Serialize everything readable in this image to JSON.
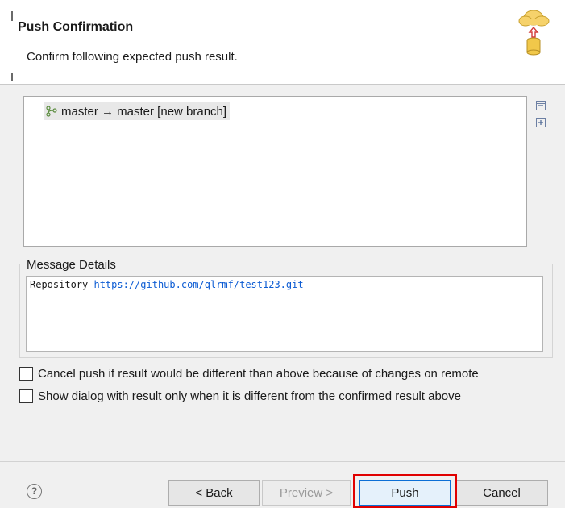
{
  "header": {
    "title": "Push Confirmation",
    "subtitle": "Confirm following expected push result."
  },
  "tree": {
    "items": [
      {
        "label": "master → master [new branch]",
        "icon": "branch-icon"
      }
    ],
    "collapse_all_icon": "collapse-all-icon",
    "expand_all_icon": "expand-all-icon"
  },
  "message_details": {
    "label": "Message Details",
    "prefix": "Repository",
    "link": "https://github.com/qlrmf/test123.git"
  },
  "options": [
    {
      "label": "Cancel push if result would be different than above because of changes on remote",
      "checked": false
    },
    {
      "label": "Show dialog with result only when it is different from the confirmed result above",
      "checked": false
    }
  ],
  "footer": {
    "help_glyph": "?",
    "back_label": "< Back",
    "preview_label": "Preview >",
    "push_label": "Push",
    "cancel_label": "Cancel"
  },
  "colors": {
    "highlight": "#e00000",
    "link": "#0b5bd3"
  }
}
